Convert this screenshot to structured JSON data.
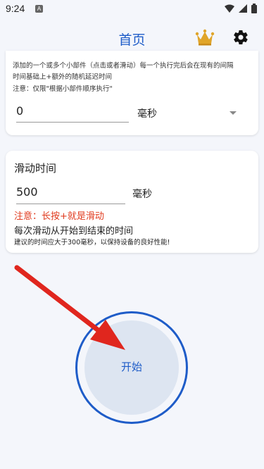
{
  "status_bar": {
    "time": "9:24",
    "notif_letter": "A"
  },
  "app_bar": {
    "title": "首页"
  },
  "interval_card": {
    "description_line1": "添加的一个或多个小部件（点击或者滑动）每一个执行完后会在现有的间隔",
    "description_line2": "时间基础上+额外的随机延迟时间",
    "note": "注意：仅限\"根据小部件顺序执行\"",
    "value": "0",
    "unit": "毫秒"
  },
  "swipe_card": {
    "title": "滑动时间",
    "value": "500",
    "unit": "毫秒",
    "warning": "注意：长按+就是滑动",
    "description": "每次滑动从开始到结束的时间",
    "hint": "建议的时间应大于300毫秒，以保持设备的良好性能!"
  },
  "start_button": {
    "label": "开始"
  },
  "colors": {
    "accent": "#1e5cc8",
    "warning": "#e03a1e",
    "arrow": "#e0261e",
    "crown": "#e0a52a"
  }
}
